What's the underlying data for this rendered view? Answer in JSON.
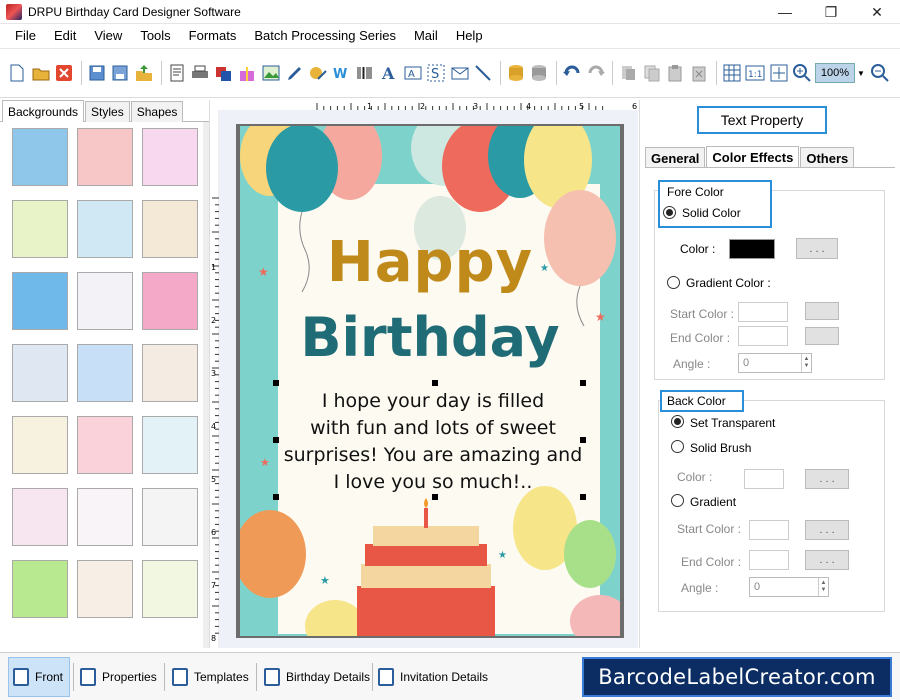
{
  "window": {
    "title": "DRPU Birthday Card Designer Software",
    "minimize": "—",
    "maximize": "❐",
    "close": "✕"
  },
  "menu": [
    "File",
    "Edit",
    "View",
    "Tools",
    "Formats",
    "Batch Processing Series",
    "Mail",
    "Help"
  ],
  "toolbar": {
    "zoom_value": "100%"
  },
  "left_panel": {
    "tabs": [
      "Backgrounds",
      "Styles",
      "Shapes"
    ],
    "active_tab": "Backgrounds",
    "thumbnails": [
      "#8fc7ea",
      "#f7c6c6",
      "#f7d8ee",
      "#e8f4c8",
      "#cfe8f4",
      "#f4e8d6",
      "#6fb8ea",
      "#f2f2f7",
      "#f4a9c8",
      "#dfe8f2",
      "#c8e0f7",
      "#f4ece2",
      "#f7f2e0",
      "#f9d2da",
      "#e2f2f7",
      "#f7e6f0",
      "#f9f4f7",
      "#f4f4f4",
      "#b8e890",
      "#f7eee6",
      "#f2f7e2"
    ]
  },
  "card": {
    "title1": "Happy",
    "title2": "Birthday",
    "message_lines": [
      "I hope your day is filled",
      "with fun and lots of sweet",
      "surprises! You are amazing and",
      "I love you so much!.."
    ]
  },
  "ruler": {
    "ticks": [
      "1",
      "2",
      "3",
      "4",
      "5",
      "6",
      "7"
    ],
    "left_ticks": [
      "1",
      "2",
      "3",
      "4",
      "5",
      "6",
      "7",
      "8"
    ]
  },
  "right_panel": {
    "title": "Text Property",
    "tabs": [
      "General",
      "Color Effects",
      "Others"
    ],
    "active_tab": "Color Effects",
    "fore_color": {
      "heading": "Fore Color",
      "solid_label": "Solid Color",
      "color_label": "Color :",
      "color_value": "#000000",
      "dots": ". . .",
      "gradient_label": "Gradient Color :",
      "start_label": "Start Color :",
      "end_label": "End Color :",
      "angle_label": "Angle :",
      "angle_value": "0"
    },
    "back_color": {
      "heading": "Back Color",
      "transparent_label": "Set Transparent",
      "solid_label": "Solid Brush",
      "color_label": "Color :",
      "dots": ". . .",
      "gradient_label": "Gradient",
      "start_label": "Start Color :",
      "end_label": "End Color :",
      "angle_label": "Angle :",
      "angle_value": "0"
    }
  },
  "bottom_tabs": [
    "Front",
    "Properties",
    "Templates",
    "Birthday Details",
    "Invitation Details"
  ],
  "banner": "BarcodeLabelCreator.com"
}
